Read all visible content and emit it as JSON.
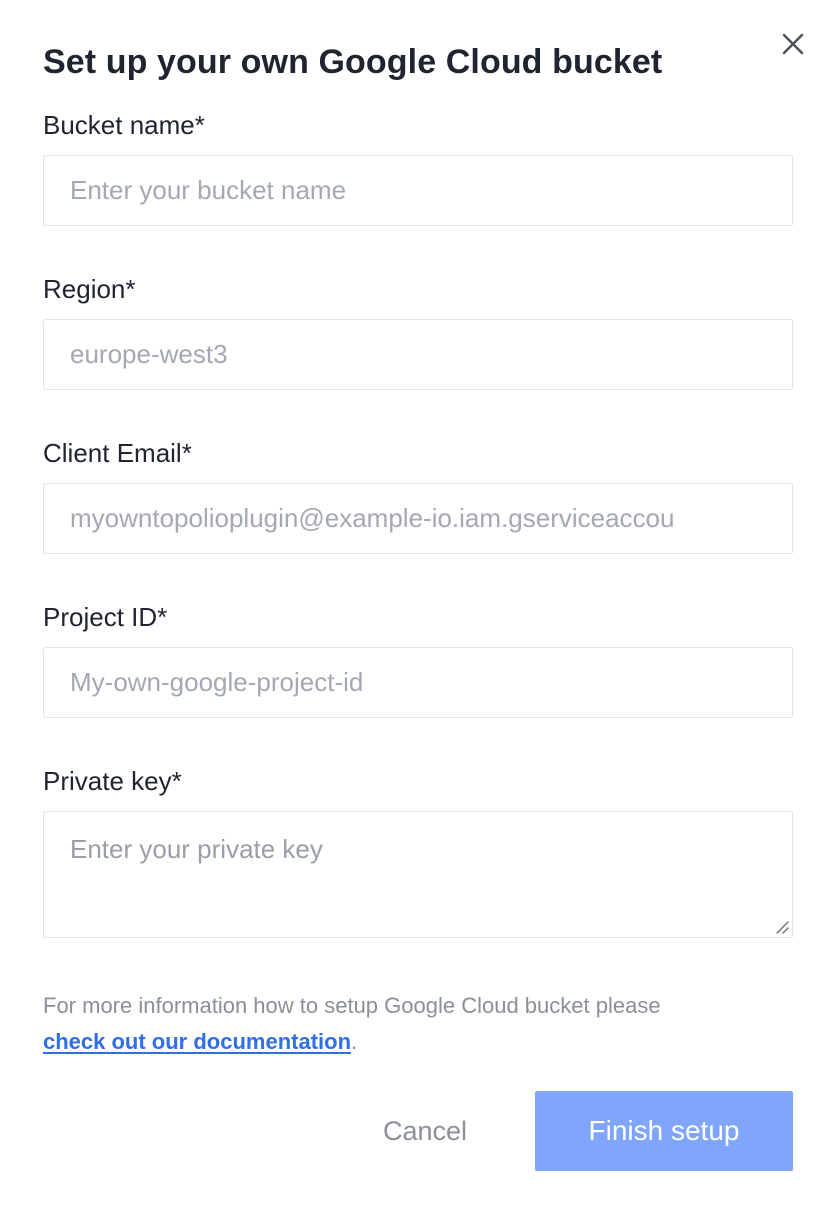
{
  "dialog": {
    "title": "Set up your own Google Cloud bucket"
  },
  "fields": {
    "bucket_name": {
      "label": "Bucket name*",
      "placeholder": "Enter your bucket name"
    },
    "region": {
      "label": "Region*",
      "placeholder": "europe-west3"
    },
    "client_email": {
      "label": "Client Email*",
      "placeholder": "myowntopolioplugin@example-io.iam.gserviceaccou"
    },
    "project_id": {
      "label": "Project ID*",
      "placeholder": "My-own-google-project-id"
    },
    "private_key": {
      "label": "Private key*",
      "placeholder": "Enter your private key"
    }
  },
  "help": {
    "text": "For more information how to setup Google Cloud bucket please",
    "link_text": "check out our documentation",
    "suffix": "."
  },
  "actions": {
    "cancel_label": "Cancel",
    "finish_label": "Finish setup"
  },
  "icons": {
    "close": "close-icon",
    "resize": "resize-handle-icon"
  },
  "colors": {
    "primary_button": "#7fa6fb",
    "link": "#2f6fe8",
    "muted_text": "#8b8f98",
    "input_border": "#e3e5ea"
  }
}
